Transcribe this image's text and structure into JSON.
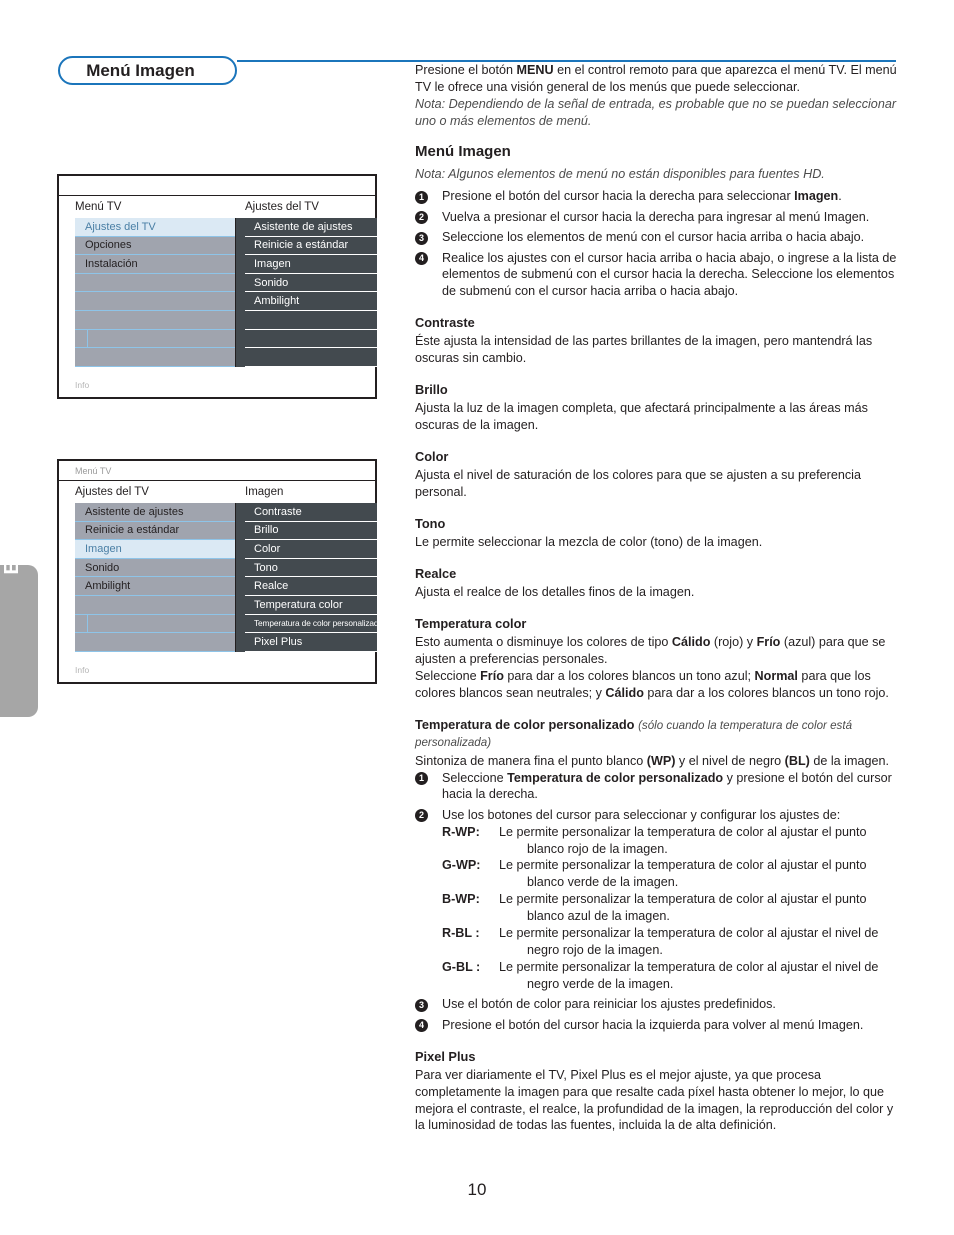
{
  "page": {
    "title_pill": "Menú Imagen",
    "language_tab": "Español",
    "page_number": "10",
    "accent_color": "#1b75bb"
  },
  "tv_menu_1": {
    "crumb": "",
    "left_header": "Menú TV",
    "right_header": "Ajustes del TV",
    "info_label": "Info",
    "left_items": [
      {
        "label": "Ajustes del TV",
        "selected": true
      },
      {
        "label": "Opciones",
        "selected": false
      },
      {
        "label": "Instalación",
        "selected": false
      },
      {
        "label": "",
        "selected": false
      },
      {
        "label": "",
        "selected": false
      },
      {
        "label": "",
        "selected": false
      },
      {
        "label": "",
        "selected": false,
        "split": true
      },
      {
        "label": "",
        "selected": false
      }
    ],
    "right_items": [
      {
        "label": "Asistente de ajustes"
      },
      {
        "label": "Reinicie a estándar"
      },
      {
        "label": "Imagen"
      },
      {
        "label": "Sonido"
      },
      {
        "label": "Ambilight"
      },
      {
        "label": ""
      },
      {
        "label": ""
      },
      {
        "label": ""
      }
    ]
  },
  "tv_menu_2": {
    "crumb": "Menú TV",
    "left_header": "Ajustes del TV",
    "right_header": "Imagen",
    "info_label": "Info",
    "left_items": [
      {
        "label": "Asistente de ajustes",
        "selected": false
      },
      {
        "label": "Reinicie a estándar",
        "selected": false
      },
      {
        "label": "Imagen",
        "selected": true
      },
      {
        "label": "Sonido",
        "selected": false
      },
      {
        "label": "Ambilight",
        "selected": false
      },
      {
        "label": "",
        "selected": false
      },
      {
        "label": "",
        "selected": false,
        "split": true
      },
      {
        "label": "",
        "selected": false
      }
    ],
    "right_items": [
      {
        "label": "Contraste"
      },
      {
        "label": "Brillo"
      },
      {
        "label": "Color"
      },
      {
        "label": "Tono"
      },
      {
        "label": "Realce"
      },
      {
        "label": "Temperatura color"
      },
      {
        "label": "Temperatura de color personalizado",
        "squeeze": true
      },
      {
        "label": "Pixel Plus"
      }
    ]
  },
  "content": {
    "intro": {
      "part1": "Presione el botón ",
      "menu_bold": "MENU",
      "part2": " en el control remoto para que aparezca el menú TV. El menú TV le ofrece una visión general de los menús que puede seleccionar."
    },
    "intro_note": "Nota: Dependiendo de la señal de entrada, es probable que no se puedan seleccionar uno o más elementos de menú.",
    "section_title": "Menú Imagen",
    "section_note": "Nota: Algunos elementos de menú no están disponibles para fuentes HD.",
    "steps": [
      {
        "pre": "Presione el botón del cursor hacia la derecha para seleccionar ",
        "bold": "Imagen",
        "post": "."
      },
      {
        "pre": "Vuelva a presionar el cursor hacia la derecha para ingresar al menú Imagen.",
        "bold": "",
        "post": ""
      },
      {
        "pre": "Seleccione los elementos de menú con el cursor hacia arriba o hacia abajo.",
        "bold": "",
        "post": ""
      },
      {
        "pre": "Realice los ajustes con el cursor hacia arriba o hacia abajo, o ingrese a la lista de elementos de submenú con el cursor hacia la derecha. Seleccione los elementos de submenú con el cursor hacia arriba o hacia abajo.",
        "bold": "",
        "post": ""
      }
    ],
    "contraste": {
      "heading": "Contraste",
      "body": "Éste ajusta la intensidad de las partes brillantes de la imagen, pero mantendrá las oscuras sin cambio."
    },
    "brillo": {
      "heading": "Brillo",
      "body": "Ajusta la luz de la imagen completa, que afectará principalmente a las áreas más oscuras de la imagen."
    },
    "color": {
      "heading": "Color",
      "body": "Ajusta el nivel de saturación de los colores para que se ajusten a su preferencia personal."
    },
    "tono": {
      "heading": "Tono",
      "body": "Le permite seleccionar la mezcla de color (tono) de la imagen."
    },
    "realce": {
      "heading": "Realce",
      "body": "Ajusta el realce de los detalles finos de la imagen."
    },
    "temperatura_color": {
      "heading": "Temperatura color",
      "p1_a": "Esto aumenta o disminuye los colores de tipo ",
      "p1_b": "Cálido",
      "p1_c": " (rojo) y ",
      "p1_d": "Frío",
      "p1_e": " (azul) para que se ajusten a preferencias personales.",
      "p2_a": "Seleccione ",
      "p2_b": "Frío",
      "p2_c": " para dar a los colores blancos un tono azul; ",
      "p2_d": "Normal",
      "p2_e": " para que los colores blancos sean neutrales; y ",
      "p2_f": "Cálido",
      "p2_g": " para dar a los colores blancos un tono rojo."
    },
    "temperatura_personalizado": {
      "heading": "Temperatura de color personalizado",
      "heading_note": "(sólo cuando la temperatura de color está personalizada)",
      "intro_a": "Sintoniza de manera fina el punto blanco ",
      "intro_wp": "(WP)",
      "intro_b": " y el nivel de negro ",
      "intro_bl": "(BL)",
      "intro_c": " de la imagen.",
      "step1_a": "Seleccione ",
      "step1_b": "Temperatura de color personalizado",
      "step1_c": " y presione el botón del cursor hacia la derecha.",
      "step2_intro": "Use los botones del cursor para seleccionar y configurar los ajustes de:",
      "definitions": [
        {
          "key": "R-WP",
          "sep": ":",
          "line1": "Le permite personalizar la temperatura de color al ajustar el punto",
          "line2": "blanco rojo de la imagen."
        },
        {
          "key": "G-WP",
          "sep": ":",
          "line1": "Le permite personalizar la temperatura de color al ajustar el punto",
          "line2": "blanco verde de la imagen."
        },
        {
          "key": "B-WP",
          "sep": ":",
          "line1": "Le permite personalizar la temperatura de color al ajustar el punto",
          "line2": "blanco azul de la imagen."
        },
        {
          "key": "R-BL",
          "sep": " :",
          "line1": "Le permite personalizar la temperatura de color al ajustar el nivel de",
          "line2": "negro rojo de la imagen."
        },
        {
          "key": "G-BL",
          "sep": " :",
          "line1": "Le permite personalizar la temperatura de color al ajustar el nivel de",
          "line2": "negro verde de la imagen."
        }
      ],
      "step3": "Use el botón de color para reiniciar los ajustes predefinidos.",
      "step4": "Presione el botón del cursor hacia la izquierda para volver al menú Imagen."
    },
    "pixel_plus": {
      "heading": "Pixel Plus",
      "body": "Para ver diariamente el TV, Pixel Plus es el mejor ajuste, ya que procesa completamente la imagen para que resalte cada píxel hasta obtener lo mejor, lo que mejora el contraste, el realce, la profundidad de la imagen, la reproducción del color y la luminosidad de todas las fuentes, incluida la de alta definición."
    }
  }
}
